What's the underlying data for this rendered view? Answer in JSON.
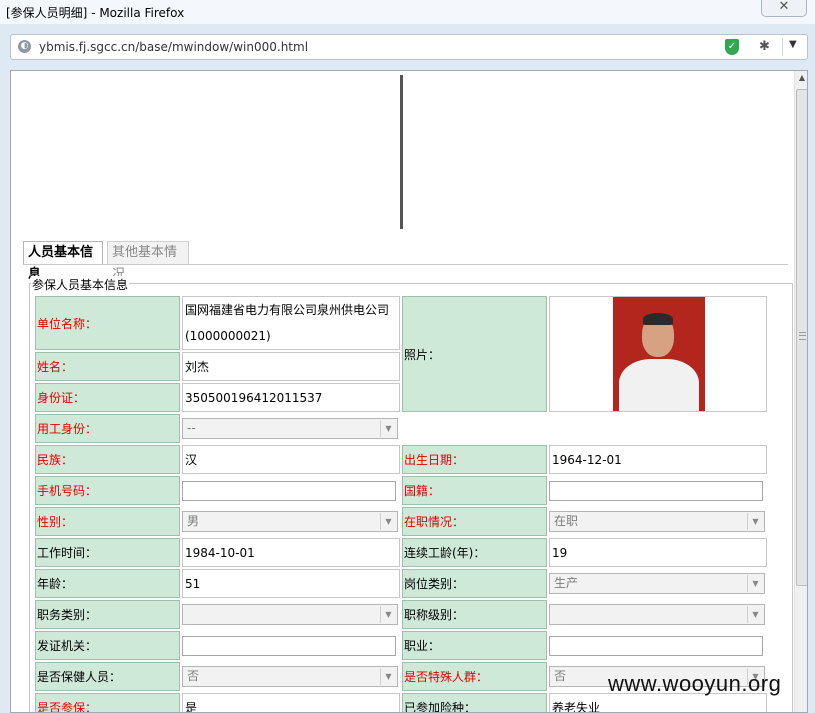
{
  "window": {
    "title": "[参保人员明细] - Mozilla Firefox",
    "close_glyph": "✕"
  },
  "browser": {
    "url": "ybmis.fj.sgcc.cn/base/mwindow/win000.html"
  },
  "icons": {
    "globe": "globe-icon",
    "shield": "shield-check-icon",
    "bug": "bug-icon",
    "menu": "chevron-down-icon"
  },
  "colors": {
    "label_bg": "#cfe9d9",
    "required": "#e00000"
  },
  "tabs": [
    {
      "label": "人员基本信息",
      "active": true
    },
    {
      "label": "其他基本情况",
      "active": false
    }
  ],
  "section": {
    "legend": "参保人员基本信息"
  },
  "form": {
    "unit_name": {
      "label": "单位名称：",
      "value_line1": "国网福建省电力有限公司泉州供电公司",
      "value_line2": "(1000000021)"
    },
    "photo": {
      "label": "照片："
    },
    "name": {
      "label": "姓名：",
      "value": "刘杰"
    },
    "id_card": {
      "label": "身份证：",
      "value": "350500196412011537"
    },
    "employment_identity": {
      "label": "用工身份：",
      "value": "--"
    },
    "ethnicity": {
      "label": "民族：",
      "value": "汉"
    },
    "birth_date": {
      "label": "出生日期：",
      "value": "1964-12-01"
    },
    "mobile": {
      "label": "手机号码：",
      "value": ""
    },
    "nationality": {
      "label": "国籍：",
      "value": ""
    },
    "gender": {
      "label": "性别：",
      "value": "男"
    },
    "employment_status": {
      "label": "在职情况：",
      "value": "在职"
    },
    "work_start": {
      "label": "工作时间：",
      "value": "1984-10-01"
    },
    "continuous_years": {
      "label": "连续工龄(年)：",
      "value": "19"
    },
    "age": {
      "label": "年龄：",
      "value": "51"
    },
    "post_category": {
      "label": "岗位类别：",
      "value": "生产"
    },
    "duty_category": {
      "label": "职务类别：",
      "value": ""
    },
    "title_level": {
      "label": "职称级别：",
      "value": ""
    },
    "issuing_authority": {
      "label": "发证机关：",
      "value": ""
    },
    "occupation": {
      "label": "职业：",
      "value": ""
    },
    "health_care": {
      "label": "是否保健人员：",
      "value": "否"
    },
    "special_group": {
      "label": "是否特殊人群：",
      "value": "否"
    },
    "insured": {
      "label": "是否参保：",
      "value": "是"
    },
    "insurance_types": {
      "label": "已参加险种：",
      "value": "养老失业"
    }
  },
  "watermark": "www.wooyun.org"
}
